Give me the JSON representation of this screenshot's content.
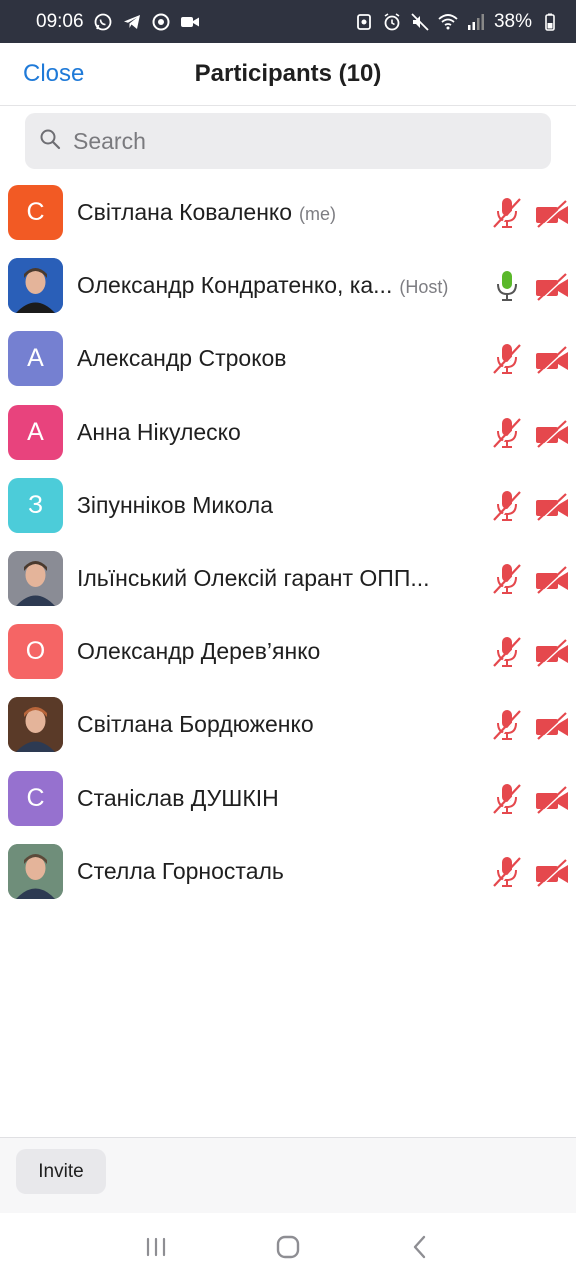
{
  "status_bar": {
    "time": "09:06",
    "battery": "38%"
  },
  "header": {
    "close_label": "Close",
    "title": "Participants (10)"
  },
  "search": {
    "placeholder": "Search"
  },
  "participants": [
    {
      "name": "Світлана Коваленко",
      "tag": "(me)",
      "initial": "С",
      "avatar_color": "#f25a24",
      "avatar_type": "initial",
      "mic": "muted",
      "video": "off"
    },
    {
      "name": "Олександр Кондратенко, ка...",
      "tag": "(Host)",
      "initial": "",
      "avatar_color": "#2a5fb8",
      "avatar_type": "photo",
      "mic": "on",
      "video": "off"
    },
    {
      "name": "Александр Строков",
      "tag": "",
      "initial": "А",
      "avatar_color": "#7580d1",
      "avatar_type": "initial",
      "mic": "muted",
      "video": "off"
    },
    {
      "name": "Анна Нікулеско",
      "tag": "",
      "initial": "А",
      "avatar_color": "#e8437d",
      "avatar_type": "initial",
      "mic": "muted",
      "video": "off"
    },
    {
      "name": "Зіпунніков Микола",
      "tag": "",
      "initial": "З",
      "avatar_color": "#4cccd9",
      "avatar_type": "initial",
      "mic": "muted",
      "video": "off"
    },
    {
      "name": "Ільїнський Олексій гарант ОПП...",
      "tag": "",
      "initial": "",
      "avatar_color": "#8a8c95",
      "avatar_type": "photo",
      "mic": "muted",
      "video": "off"
    },
    {
      "name": "Олександр Дерев’янко",
      "tag": "",
      "initial": "О",
      "avatar_color": "#f56565",
      "avatar_type": "initial",
      "mic": "muted",
      "video": "off"
    },
    {
      "name": "Світлана Бордюженко",
      "tag": "",
      "initial": "",
      "avatar_color": "#5a3a28",
      "avatar_type": "photo",
      "mic": "muted",
      "video": "off"
    },
    {
      "name": "Станіслав ДУШКІН",
      "tag": "",
      "initial": "С",
      "avatar_color": "#9671cf",
      "avatar_type": "initial",
      "mic": "muted",
      "video": "off"
    },
    {
      "name": "Стелла Горносталь",
      "tag": "",
      "initial": "",
      "avatar_color": "#6f8e7a",
      "avatar_type": "photo",
      "mic": "muted",
      "video": "off"
    }
  ],
  "footer": {
    "invite_label": "Invite"
  },
  "colors": {
    "accent": "#1f7ad8",
    "muted_red": "#e5484d",
    "mic_on_green": "#5ab82a"
  }
}
